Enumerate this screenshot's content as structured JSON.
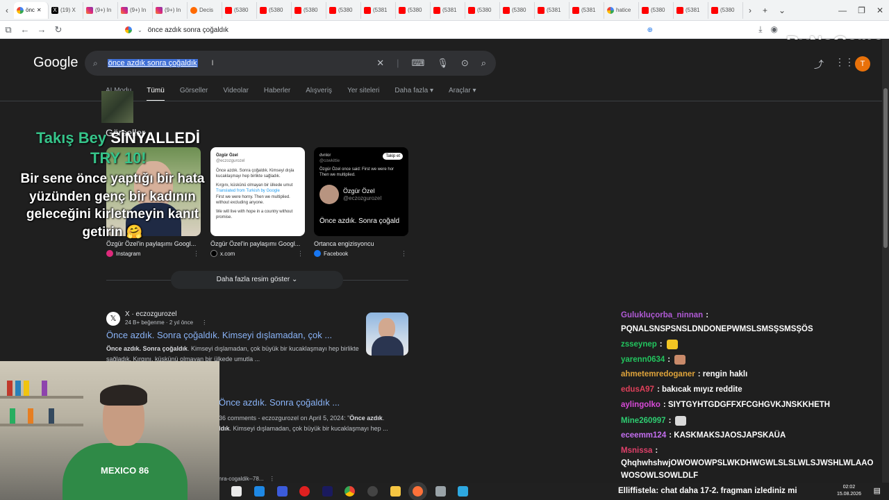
{
  "browser": {
    "tabs": [
      {
        "label": "önc",
        "icon": "google",
        "active": true
      },
      {
        "label": "(19) X",
        "icon": "x"
      },
      {
        "label": "(9+) In",
        "icon": "instagram"
      },
      {
        "label": "(9+) In",
        "icon": "instagram"
      },
      {
        "label": "(9+) In",
        "icon": "instagram"
      },
      {
        "label": "Decis",
        "icon": "decis"
      },
      {
        "label": "(5380",
        "icon": "youtube"
      },
      {
        "label": "(5380",
        "icon": "youtube"
      },
      {
        "label": "(5380",
        "icon": "youtube"
      },
      {
        "label": "(5380",
        "icon": "youtube"
      },
      {
        "label": "(5381",
        "icon": "youtube"
      },
      {
        "label": "(5380",
        "icon": "youtube"
      },
      {
        "label": "(5381",
        "icon": "youtube"
      },
      {
        "label": "(5380",
        "icon": "youtube"
      },
      {
        "label": "(5380",
        "icon": "youtube"
      },
      {
        "label": "(5381",
        "icon": "youtube"
      },
      {
        "label": "(5381",
        "icon": "youtube"
      },
      {
        "label": "hatice",
        "icon": "google"
      },
      {
        "label": "(5380",
        "icon": "youtube"
      },
      {
        "label": "(5381",
        "icon": "youtube"
      },
      {
        "label": "(5380",
        "icon": "youtube"
      }
    ],
    "address": "önce azdık sonra çoğaldık",
    "watermark": "ByNoGame"
  },
  "google": {
    "logo": "Google",
    "query": "önce azdık sonra çoğaldık",
    "avatar_letter": "T",
    "tabs": [
      "AI Modu",
      "Tümü",
      "Görseller",
      "Videolar",
      "Haberler",
      "Alışveriş",
      "Yer siteleri",
      "Daha fazla ▾",
      "Araçlar ▾"
    ],
    "images_heading": "Görseller",
    "images": [
      {
        "caption": "Özgür Özel'in paylaşımı Googl...",
        "source": "Instagram",
        "source_color": "#dd2a7b"
      },
      {
        "caption": "Özgür Özel'in paylaşımı Googl...",
        "source": "x.com",
        "source_color": "#000000"
      },
      {
        "caption": "Ortanca engizisyoncu",
        "source": "Facebook",
        "source_color": "#1877f2"
      }
    ],
    "tweet2": {
      "name": "Özgür Özel",
      "handle": "@eczozgurozel",
      "lines": [
        "Önce azdık. Sonra çoğaldık. Kimseyi dışla",
        "kucaklaşmayı hep birlikte sağladık.",
        "",
        "Kırgını, küskünü olmayan bir ülkede umut",
        "Translated from Turkish by Google",
        "First we were horny. Then we multiplied.",
        "without excluding anyone.",
        "",
        "We will live with hope in a country without",
        "promise."
      ]
    },
    "tweet3": {
      "user": "dvnlor",
      "handle": "@cowkittie",
      "follow": "Takip et",
      "lines": [
        "Özgür Özel once said: First we were hor",
        "Then we multiplied."
      ],
      "name": "Özgür Özel",
      "inner_handle": "@eczozgurozel",
      "quote": "Önce azdık. Sonra çoğald"
    },
    "more_images": "Daha fazla resim göster",
    "result1": {
      "site": "X · eczozgurozel",
      "meta": "24 B+ beğenme · 2 yıl önce",
      "title": "Önce azdık. Sonra çoğaldık. Kimseyi dışlamadan, çok ...",
      "snippet_bold": "Önce azdık. Sonra çoğaldık",
      "snippet": ". Kimseyi dışlamadan, çok büyük bir kucaklaşmayı hep birlikte sağladık. Kırgını, küskünü olmayan bir ülkede umutla ..."
    },
    "result2": {
      "title": "Önce azdık. Sonra çoğaldık ...",
      "snippet_a": "36 comments - eczozgurozel on April 5, 2024: \"",
      "snippet_bold": "Önce azdık",
      "snippet_b": ".",
      "snippet_bold2": "ldık",
      "snippet_c": ". Kimseyi dışlamadan, çok büyük bir kucaklaşmayı hep ..."
    },
    "result3_url": "nra-cogaldik--78..."
  },
  "overlay": {
    "title_green": "Takış Bey ",
    "title_white": "SİNYALLEDİ",
    "try": "TRY 10!",
    "message": "Bir sene önce yaptığı bir hata yüzünden genç bir kadının geleceğini kirletmeyin kanıt getirin 🤗"
  },
  "webcam": {
    "shirt_text": "MEXICO 86"
  },
  "chat": [
    {
      "user": "Gulukluçorba_ninnan",
      "color": "#b15ad6",
      "text": ":"
    },
    {
      "user": "",
      "color": "#ffffff",
      "text": "PQNALSNSPSNSLDNDONEPWMSLSMSŞSMSŞÖS"
    },
    {
      "user": "zsseynep",
      "color": "#22c55e",
      "text": ":"
    },
    {
      "user": "yarenn0634",
      "color": "#22c55e",
      "text": ":"
    },
    {
      "user": "ahmetemredoganer",
      "color": "#e0a43b",
      "text": ": rengin haklı"
    },
    {
      "user": "edusA97",
      "color": "#e0405a",
      "text": ": bakıcak mıyız reddite"
    },
    {
      "user": "aylingolko",
      "color": "#d94ad9",
      "text": ": SIYTGYHTGDGFFXFCGHGVKJNSKKHETH"
    },
    {
      "user": "Mine260997",
      "color": "#2ecc71",
      "text": ":"
    },
    {
      "user": "eceemm124",
      "color": "#c46ef0",
      "text": ": KASKMAKSJAOSJAPSKAÜA"
    },
    {
      "user": "Msnissa",
      "color": "#e0406a",
      "text": ":"
    },
    {
      "user": "",
      "color": "#ffffff",
      "text": "QhqhwhshwjOWOWOWPSLWKDHWGWLSLSLWLSJWSHLWLAAO"
    },
    {
      "user": "",
      "color": "#ffffff",
      "text": "WOSOWLSOWLDLF"
    }
  ],
  "taskbar": {
    "ticker_user": "Elliffistela",
    "ticker_text": ": chat daha 17-2. fragman izlediniz mi",
    "time": "02:02",
    "date": "15.08.2026"
  }
}
